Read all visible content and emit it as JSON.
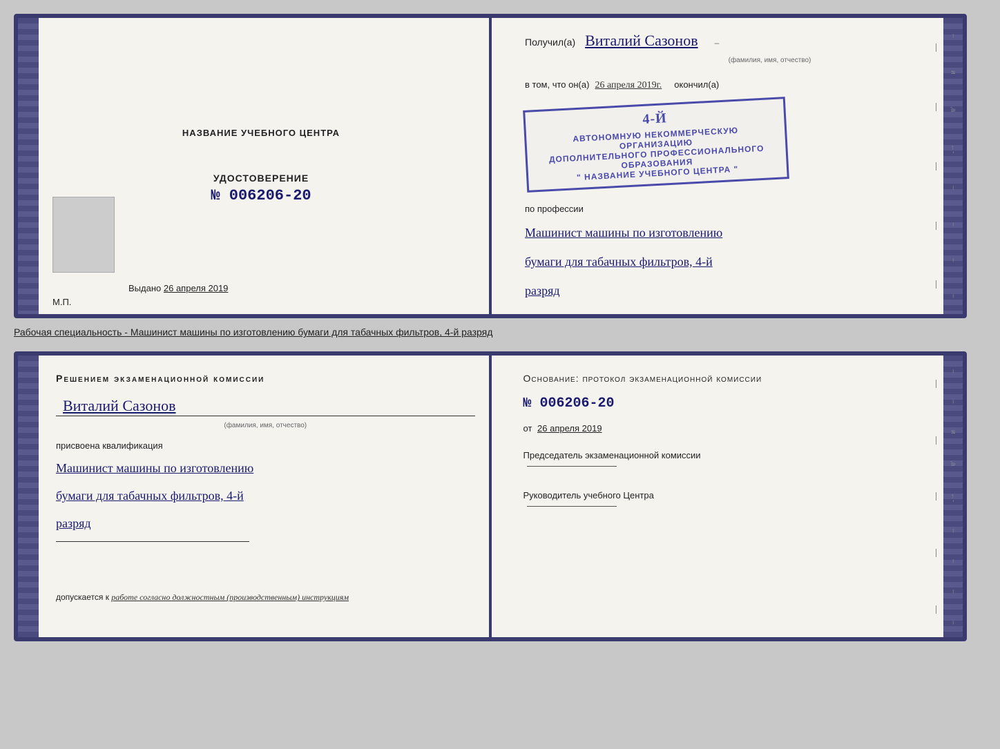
{
  "page": {
    "background": "#c8c8c8"
  },
  "top_diploma": {
    "left": {
      "center_title": "НАЗВАНИЕ УЧЕБНОГО ЦЕНТРА",
      "cert_label": "УДОСТОВЕРЕНИЕ",
      "cert_number": "№ 006206-20",
      "issued_prefix": "Выдано",
      "issued_date": "26 апреля 2019",
      "mp_label": "М.П."
    },
    "right": {
      "received_prefix": "Получил(а)",
      "recipient_name": "Виталий Сазонов",
      "fio_label": "(фамилия, имя, отчество)",
      "in_that_prefix": "в том, что он(а)",
      "date_value": "26 апреля 2019г.",
      "finished_label": "окончил(а)",
      "stamp_number": "4-й",
      "stamp_line1": "АВТОНОМНУЮ НЕКОММЕРЧЕСКУЮ ОРГАНИЗАЦИЮ",
      "stamp_line2": "ДОПОЛНИТЕЛЬНОГО ПРОФЕССИОНАЛЬНОГО ОБРАЗОВАНИЯ",
      "stamp_line3": "\" НАЗВАНИЕ УЧЕБНОГО ЦЕНТРА \"",
      "profession_prefix": "по профессии",
      "profession_line1": "Машинист машины по изготовлению",
      "profession_line2": "бумаги для табачных фильтров, 4-й",
      "profession_line3": "разряд"
    }
  },
  "middle_label": "Рабочая специальность - Машинист машины по изготовлению бумаги для табачных фильтров, 4-й разряд",
  "bottom_diploma": {
    "left": {
      "commission_title": "Решением  экзаменационной  комиссии",
      "person_name": "Виталий Сазонов",
      "fio_label": "(фамилия, имя, отчество)",
      "assigned_label": "присвоена квалификация",
      "qualification_line1": "Машинист машины по изготовлению",
      "qualification_line2": "бумаги для табачных фильтров, 4-й",
      "qualification_line3": "разряд",
      "allowed_prefix": "допускается к",
      "allowed_value": "работе согласно должностным (производственным) инструкциям"
    },
    "right": {
      "basis_title": "Основание: протокол экзаменационной  комиссии",
      "number": "№  006206-20",
      "date_prefix": "от",
      "date_value": "26 апреля 2019",
      "chairman_title": "Председатель экзаменационной комиссии",
      "manager_title": "Руководитель учебного Центра"
    }
  }
}
